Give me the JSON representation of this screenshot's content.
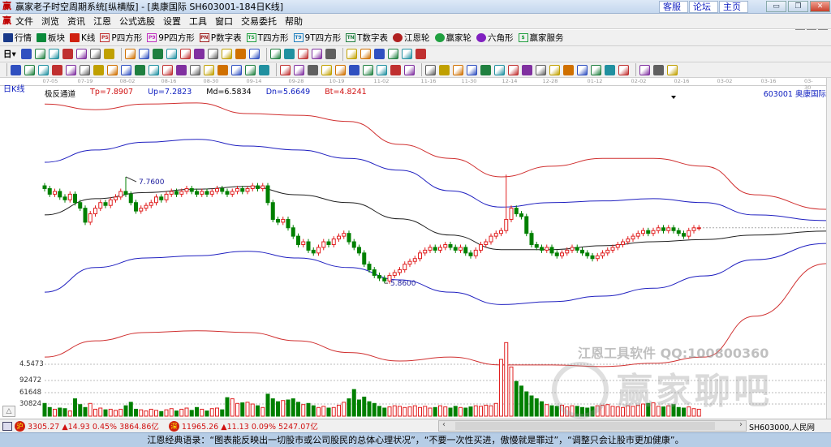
{
  "window": {
    "title": "赢家老子时空周期系统[纵横版] - [奥康国际  SH603001-184日K线]",
    "links": [
      "客服",
      "论坛",
      "主页"
    ],
    "controls": [
      "minimize",
      "restore",
      "close"
    ]
  },
  "menu": [
    "文件",
    "浏览",
    "资讯",
    "江恩",
    "公式选股",
    "设置",
    "工具",
    "窗口",
    "交易委托",
    "帮助"
  ],
  "toolbar1": [
    {
      "label": "行情",
      "icon": "quote-grid-icon",
      "badge": "",
      "color": "#1a3a8a"
    },
    {
      "label": "板块",
      "icon": "sector-icon",
      "badge": "",
      "color": "#0a8a3a"
    },
    {
      "label": "K线",
      "icon": "kline-icon",
      "badge": "",
      "color": "#d02010"
    },
    {
      "label": "P四方形",
      "icon": "p-square-icon",
      "badge": "PS",
      "color": "#c03030"
    },
    {
      "label": "9P四方形",
      "icon": "9p-square-icon",
      "badge": "P9",
      "color": "#c030c0"
    },
    {
      "label": "P数字表",
      "icon": "p-number-table-icon",
      "badge": "PN",
      "color": "#a02020"
    },
    {
      "label": "T四方形",
      "icon": "t-square-icon",
      "badge": "TS",
      "color": "#20a040"
    },
    {
      "label": "9T四方形",
      "icon": "9t-square-icon",
      "badge": "T9",
      "color": "#2080c0"
    },
    {
      "label": "T数字表",
      "icon": "t-number-table-icon",
      "badge": "TN",
      "color": "#208040"
    },
    {
      "label": "江恩轮",
      "icon": "gann-wheel-icon",
      "badge": "",
      "color": "#b02020"
    },
    {
      "label": "赢家轮",
      "icon": "winner-wheel-icon",
      "badge": "",
      "color": "#20a040"
    },
    {
      "label": "六角形",
      "icon": "hexagon-icon",
      "badge": "",
      "color": "#8020c0"
    },
    {
      "label": "赢家服务",
      "icon": "dollar-icon",
      "badge": "$",
      "color": "#20a040"
    }
  ],
  "toolbar2": {
    "period": "日",
    "icons": [
      "indicator-icon",
      "info-icon",
      "bar-icon",
      "bar2-icon",
      "candle-icon",
      "gann-icon",
      "color-icon",
      "first-icon",
      "last-icon",
      "left-icon",
      "right-icon",
      "zoom1-icon",
      "zoom2-icon",
      "zoom3-icon",
      "zoom4-icon",
      "zoom5-icon",
      "zoom6-icon",
      "hand-icon",
      "crosshair-icon",
      "line-icon",
      "cycle-icon",
      "fib-icon",
      "calendar-icon",
      "calculator-icon",
      "report-icon",
      "save-icon",
      "network-icon",
      "truck-icon"
    ]
  },
  "toolbar3": {
    "icons": [
      "pen-icon",
      "lines-icon",
      "gold1-icon",
      "gold2-icon",
      "f-icon",
      "wave-icon",
      "fan-icon",
      "circle-icon",
      "parallel-icon",
      "n2-icon",
      "angle-icon",
      "target-icon",
      "star-icon",
      "box-icon",
      "tick-icon",
      "red-fan-icon",
      "grid-icon",
      "hbar-icon",
      "vbar-icon",
      "rect-icon",
      "ray-icon",
      "box2-icon",
      "box3-icon",
      "shade-icon",
      "angle2-icon",
      "v-icon",
      "grid2-icon",
      "grid3-icon",
      "stripes-icon",
      "ee-icon",
      "percent-fan-icon",
      "percent-icon",
      "percent-line-icon",
      "coin-icon",
      "gold-line-icon",
      "arrow-icon",
      "gann-line-icon",
      "gold3-icon",
      "angle3-icon",
      "f2-icon",
      "angle4-icon",
      "angle5-icon",
      "angle6-icon",
      "angle7-icon",
      "table-icon",
      "palette-icon",
      "infinity-icon"
    ]
  },
  "chart": {
    "period_label": "日K线",
    "indicator": {
      "name": "极反通道",
      "tp": "Tp=7.8907",
      "up": "Up=7.2823",
      "md": "Md=6.5834",
      "dn": "Dn=5.6649",
      "bt": "Bt=4.8241"
    },
    "stock": "603001  奥康国际",
    "dates": [
      "07-05",
      "07-19",
      "08-02",
      "08-16",
      "08-30",
      "09-14",
      "09-28",
      "10-19",
      "11-02",
      "11-16",
      "11-30",
      "12-14",
      "12-28",
      "01-12",
      "02-02",
      "02-16",
      "03-02",
      "03-16",
      "03-30"
    ],
    "high_label": "7.7600",
    "low_label": "5.8600",
    "volume_axis": [
      "4.5473",
      "92472",
      "61648",
      "30824"
    ],
    "colors": {
      "up": "#e02020",
      "down": "#008000",
      "tp": "#d03030",
      "up_band": "#2020c0",
      "md": "#202020",
      "dn": "#2020c0",
      "bt": "#d03030"
    }
  },
  "chart_data": {
    "type": "candlestick",
    "closes": [
      7.55,
      7.45,
      7.5,
      7.4,
      7.35,
      7.45,
      7.3,
      7.2,
      6.95,
      7.1,
      7.2,
      7.3,
      7.25,
      7.35,
      7.4,
      7.5,
      7.45,
      7.3,
      7.15,
      7.2,
      7.25,
      7.3,
      7.4,
      7.35,
      7.45,
      7.5,
      7.45,
      7.5,
      7.55,
      7.5,
      7.45,
      7.5,
      7.45,
      7.5,
      7.55,
      7.5,
      7.45,
      7.5,
      7.55,
      7.5,
      7.55,
      7.6,
      7.55,
      7.6,
      7.3,
      7.0,
      6.95,
      7.0,
      6.85,
      6.7,
      6.55,
      6.6,
      6.45,
      6.4,
      6.5,
      6.6,
      6.55,
      6.65,
      6.7,
      6.75,
      6.6,
      6.5,
      6.4,
      6.2,
      6.1,
      6.0,
      5.95,
      5.9,
      6.0,
      6.05,
      6.1,
      6.2,
      6.25,
      6.3,
      6.4,
      6.45,
      6.5,
      6.45,
      6.5,
      6.55,
      6.5,
      6.45,
      6.5,
      6.4,
      6.35,
      6.45,
      6.55,
      6.6,
      6.7,
      6.75,
      6.8,
      7.0,
      7.2,
      7.1,
      7.05,
      6.75,
      6.55,
      6.5,
      6.45,
      6.5,
      6.4,
      6.35,
      6.4,
      6.45,
      6.5,
      6.45,
      6.4,
      6.35,
      6.3,
      6.35,
      6.4,
      6.45,
      6.5,
      6.55,
      6.6,
      6.65,
      6.7,
      6.75,
      6.8,
      6.75,
      6.8,
      6.85,
      6.8,
      6.85,
      6.8,
      6.75,
      6.7,
      6.8,
      6.85,
      6.85
    ],
    "volumes": [
      22000,
      15000,
      12000,
      14000,
      13000,
      9000,
      30000,
      20000,
      15000,
      22000,
      12000,
      14000,
      11000,
      12000,
      10000,
      12000,
      18000,
      24000,
      12000,
      11000,
      9000,
      12000,
      10000,
      8000,
      11000,
      13000,
      9000,
      12000,
      14000,
      10000,
      15000,
      12000,
      9000,
      13000,
      14000,
      11000,
      32000,
      30000,
      22000,
      23000,
      24000,
      21000,
      18000,
      15000,
      38000,
      30000,
      25000,
      27000,
      28000,
      30000,
      24000,
      20000,
      22000,
      18000,
      15000,
      17000,
      14000,
      15000,
      19000,
      24000,
      30000,
      46000,
      28000,
      33000,
      25000,
      22000,
      17000,
      14000,
      16000,
      18000,
      17000,
      15000,
      16000,
      18000,
      15000,
      17000,
      14000,
      15000,
      18000,
      16000,
      14000,
      17000,
      15000,
      14000,
      16000,
      18000,
      17000,
      19000,
      18000,
      22000,
      98000,
      127000,
      85000,
      60000,
      52000,
      42000,
      35000,
      30000,
      25000,
      20000,
      18000,
      17000,
      19000,
      16000,
      18000,
      17000,
      15000,
      14000,
      16000,
      18000,
      19000,
      20000,
      17000,
      16000,
      15000,
      18000,
      17000,
      19000,
      21000,
      22000,
      23000,
      17000,
      16000,
      18000,
      20000,
      15000,
      14000,
      16000,
      13000,
      12000
    ],
    "spikes": [
      {
        "i": 16,
        "high": 7.76
      },
      {
        "i": 91,
        "high": 7.8
      },
      {
        "i": 67,
        "low": 5.86
      }
    ],
    "bands_step": 10,
    "tp": [
      9.06,
      8.96,
      9.06,
      9.08,
      8.89,
      8.86,
      8.75,
      8.34,
      8.09,
      7.76,
      7.95,
      8.09,
      8.09,
      7.95,
      7.44,
      7.18
    ],
    "up": [
      8.02,
      8.24,
      8.38,
      8.43,
      8.31,
      8.24,
      8.09,
      7.88,
      7.51,
      7.22,
      7.3,
      7.33,
      7.37,
      7.3,
      7.08,
      6.98
    ],
    "md": [
      7.08,
      7.37,
      7.48,
      7.54,
      7.59,
      7.44,
      7.3,
      7.01,
      6.72,
      6.46,
      6.46,
      6.53,
      6.6,
      6.64,
      6.72,
      6.79
    ],
    "dn": [
      5.7,
      6.14,
      6.31,
      6.35,
      6.43,
      6.31,
      6.14,
      5.92,
      5.7,
      5.48,
      5.53,
      5.63,
      5.77,
      5.99,
      6.28,
      6.57
    ],
    "bt": [
      4.54,
      4.83,
      4.98,
      5.01,
      4.98,
      4.83,
      4.62,
      4.47,
      4.54,
      4.4,
      4.4,
      4.37,
      4.43,
      4.54,
      5.27,
      6.21
    ]
  },
  "watermark": {
    "line1": "江恩工具软件  QQ:100800360",
    "line2": "赢家聊吧"
  },
  "status": {
    "sh": {
      "icon": "沪",
      "value": "3305.27",
      "change": "▲14.93",
      "pct": "0.45%",
      "amount": "3864.86亿"
    },
    "sz": {
      "icon": "深",
      "value": "11965.26",
      "change": "▲11.13",
      "pct": "0.09%",
      "amount": "5247.07亿"
    },
    "ticker": "SH603000,人民网"
  },
  "quote": "江恩经典语录：“图表能反映出一切股市或公司股民的总体心理状况”，“不要一次性买进，傲慢就是罪过”，“调整只会让股市更加健康”。"
}
